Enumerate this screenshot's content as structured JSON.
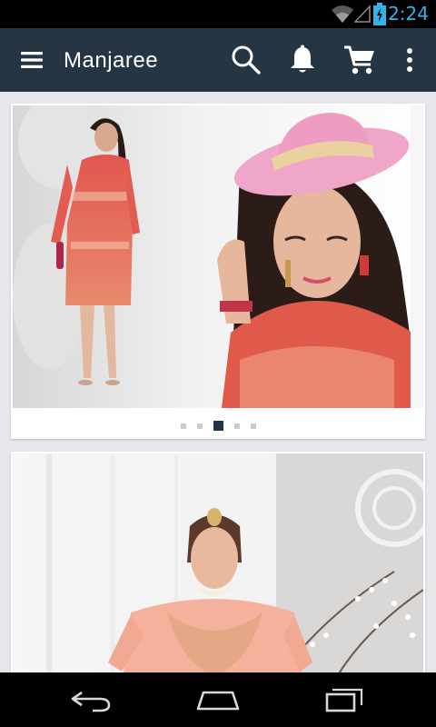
{
  "status_bar": {
    "time": "2:24",
    "icons": [
      "wifi-icon",
      "cell-signal-icon",
      "battery-charging-icon"
    ],
    "accent_color": "#35b2e6"
  },
  "app_bar": {
    "title": "Manjaree",
    "background": "#263544",
    "icons": [
      "menu-icon",
      "search-icon",
      "bell-icon",
      "cart-icon",
      "more-vert-icon"
    ]
  },
  "carousel": {
    "slide_count": 5,
    "active_index": 2,
    "active_dot_color": "#263544"
  },
  "nav_bar": {
    "icons": [
      "back-icon",
      "home-icon",
      "recents-icon"
    ]
  }
}
